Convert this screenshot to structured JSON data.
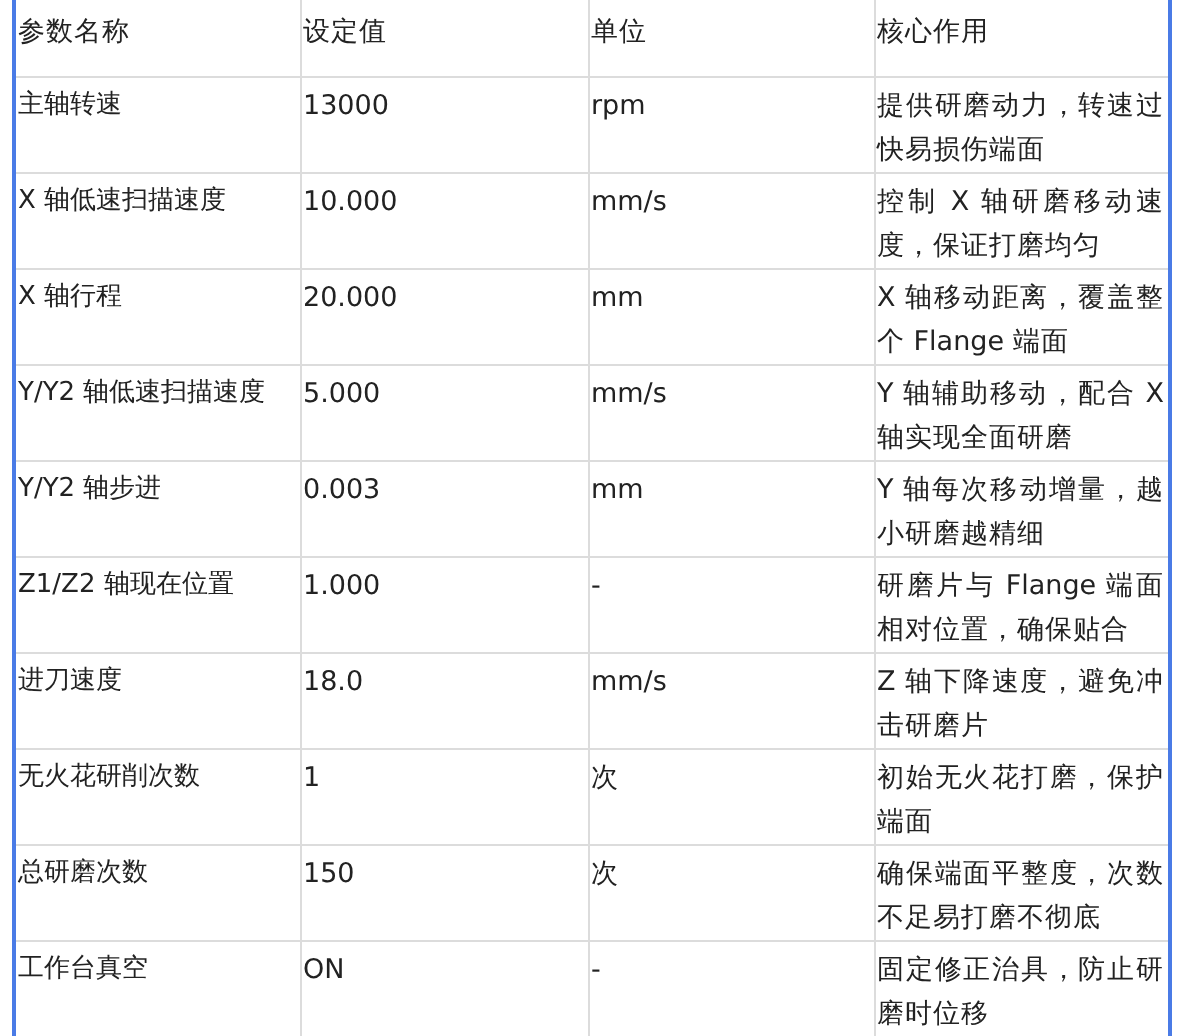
{
  "table": {
    "columns": [
      "参数名称",
      "设定值",
      "单位",
      "核心作用"
    ],
    "rows": [
      [
        "主轴转速",
        "13000",
        "rpm",
        "提供研磨动力，转速过快易损伤端面"
      ],
      [
        "X 轴低速扫描速度",
        "10.000",
        "mm/s",
        "控制 X 轴研磨移动速度，保证打磨均匀"
      ],
      [
        "X 轴行程",
        "20.000",
        "mm",
        "X 轴移动距离，覆盖整个 Flange 端面"
      ],
      [
        "Y/Y2 轴低速扫描速度",
        "5.000",
        "mm/s",
        "Y 轴辅助移动，配合 X 轴实现全面研磨"
      ],
      [
        "Y/Y2 轴步进",
        "0.003",
        "mm",
        "Y 轴每次移动增量，越小研磨越精细"
      ],
      [
        "Z1/Z2 轴现在位置",
        "1.000",
        "-",
        "研磨片与 Flange 端面相对位置，确保贴合"
      ],
      [
        "进刀速度",
        "18.0",
        "mm/s",
        "Z 轴下降速度，避免冲击研磨片"
      ],
      [
        "无火花研削次数",
        "1",
        "次",
        "初始无火花打磨，保护端面"
      ],
      [
        "总研磨次数",
        "150",
        "次",
        "确保端面平整度，次数不足易打磨不彻底"
      ],
      [
        "工作台真空",
        "ON",
        "-",
        "固定修正治具，防止研磨时位移"
      ]
    ]
  }
}
